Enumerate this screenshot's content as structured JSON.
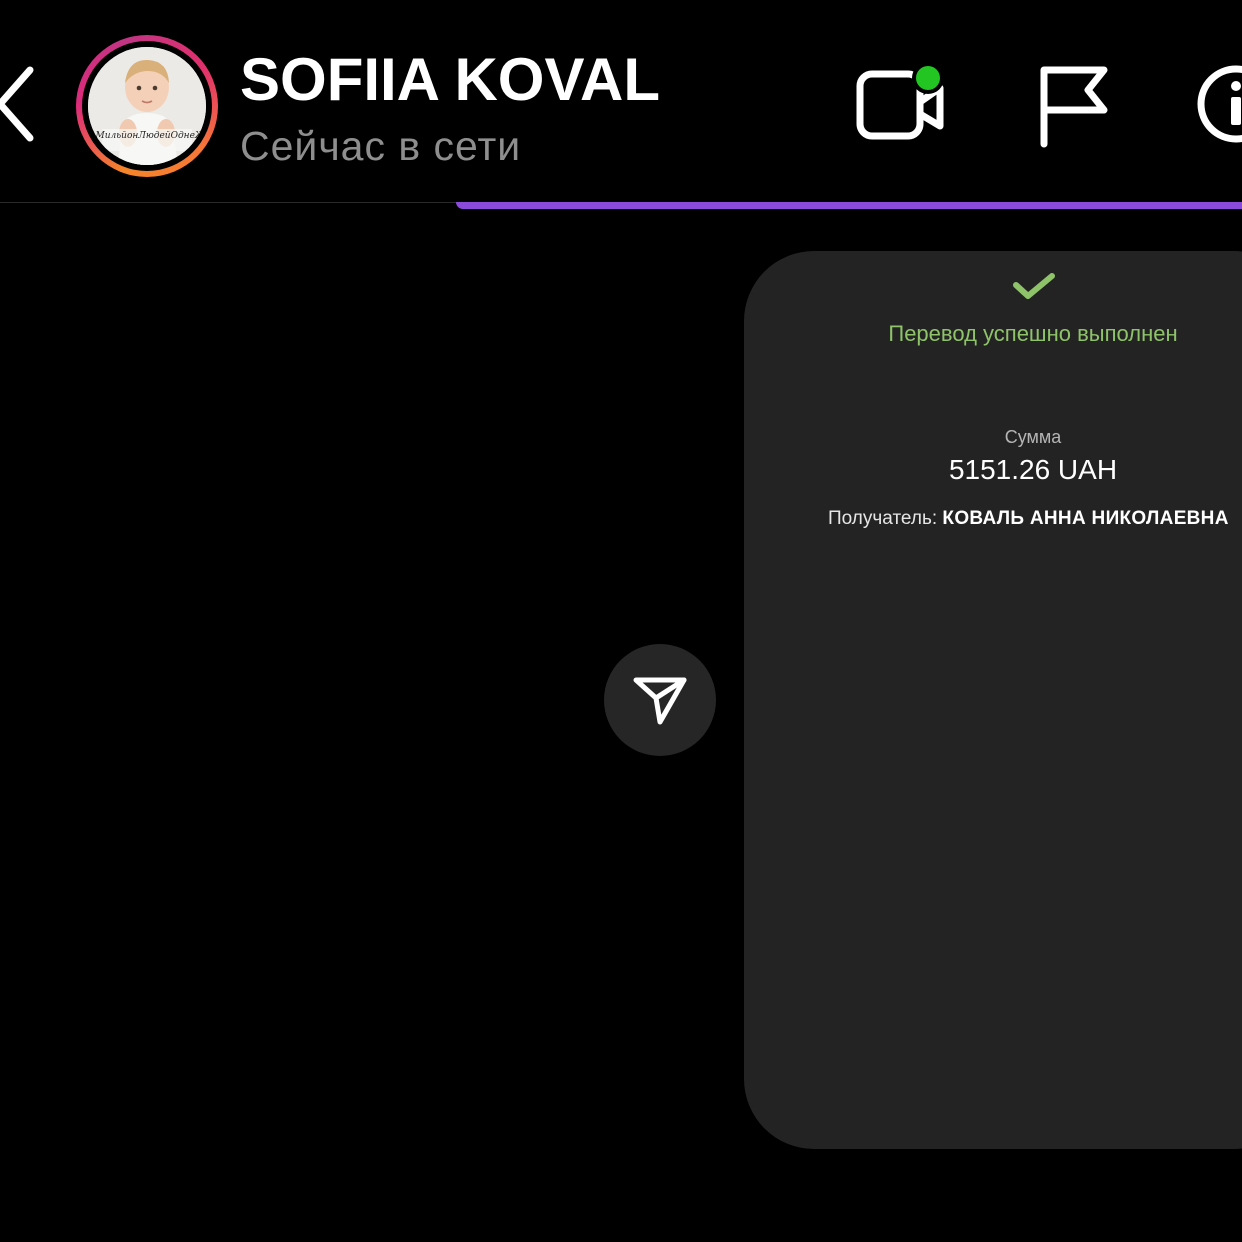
{
  "header": {
    "contact_name": "SOFIIA KOVAL",
    "status": "Сейчас в сети",
    "avatar_caption": "#МильйонЛюдейОднеЖиття",
    "icons": {
      "back": "chevron-left-icon",
      "video": "video-call-icon",
      "flag": "flag-icon",
      "info": "info-icon"
    },
    "colors": {
      "online_dot": "#22c522",
      "progress_bar": "#8a4bdb"
    }
  },
  "message": {
    "status_text": "Перевод успешно выполнен",
    "amount_label": "Сумма",
    "amount_value": "5151.26 UAH",
    "recipient_label": "Получатель:",
    "recipient_name": "КОВАЛЬ АННА НИКОЛАЕВНА",
    "colors": {
      "success": "#8ec36a",
      "card_bg": "#232323"
    }
  },
  "actions": {
    "share_icon": "send-icon"
  }
}
